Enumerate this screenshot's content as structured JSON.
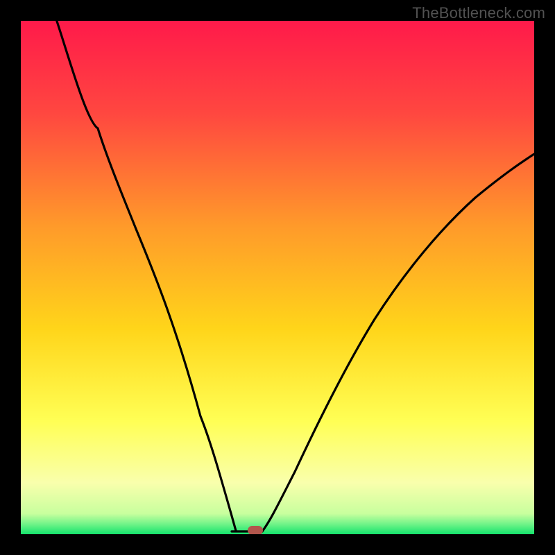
{
  "watermark": {
    "text": "TheBottleneck.com"
  },
  "colors": {
    "frame": "#000000",
    "grad_top": "#ff1a4a",
    "grad_mid1": "#ff7a2e",
    "grad_mid2": "#ffd51a",
    "grad_mid3": "#ffff6a",
    "grad_low": "#f6ffb8",
    "grad_green": "#14e36c",
    "curve": "#000000",
    "marker": "#b2564c"
  },
  "chart_data": {
    "type": "line",
    "title": "",
    "xlabel": "",
    "ylabel": "",
    "xlim": [
      0,
      100
    ],
    "ylim": [
      0,
      100
    ],
    "series": [
      {
        "name": "left-branch",
        "x": [
          7,
          10,
          15,
          20,
          25,
          30,
          35,
          38,
          40,
          41,
          43,
          44
        ],
        "values": [
          100,
          92,
          79,
          66,
          52,
          38,
          23,
          13,
          7,
          4,
          1,
          0
        ]
      },
      {
        "name": "right-branch",
        "x": [
          47,
          50,
          55,
          60,
          65,
          70,
          75,
          80,
          85,
          90,
          95,
          100
        ],
        "values": [
          0,
          5,
          15,
          24,
          33,
          41,
          49,
          56,
          62,
          67,
          71,
          74
        ]
      },
      {
        "name": "valley-flat",
        "x": [
          41,
          47
        ],
        "values": [
          0,
          0
        ]
      }
    ],
    "marker": {
      "x": 45.5,
      "y": 0.5,
      "label": ""
    },
    "annotations": []
  }
}
